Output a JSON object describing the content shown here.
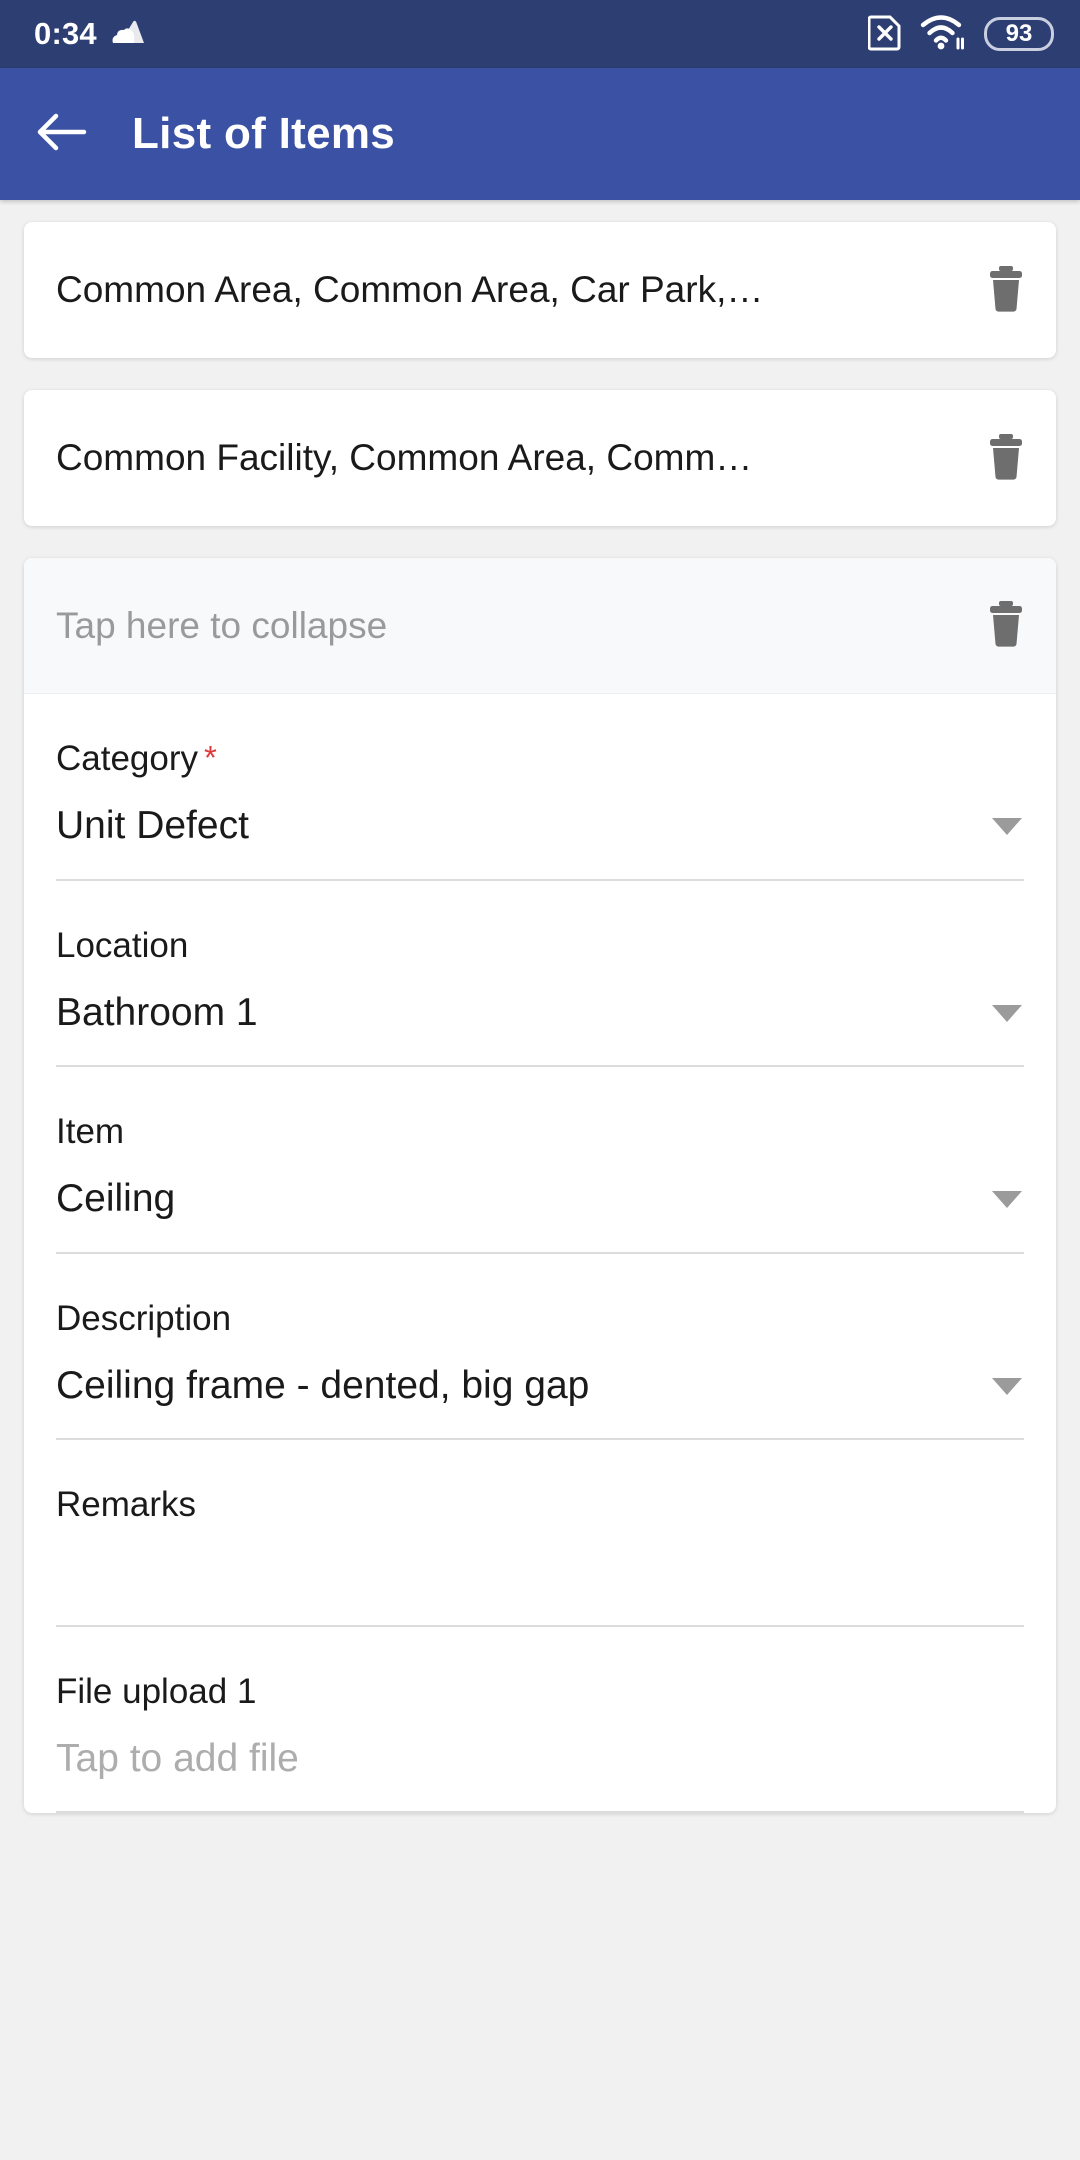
{
  "status_bar": {
    "time": "0:34",
    "cloud_icon": "cloud-icon",
    "sim_icon": "sim-card-x-icon",
    "wifi_icon": "wifi-icon",
    "battery_level": "93"
  },
  "app_bar": {
    "back_icon": "back-arrow-icon",
    "title": "List of Items"
  },
  "items": [
    {
      "title": "Common Area, Common Area, Car Park,…",
      "delete_icon": "trash-icon"
    },
    {
      "title": "Common Facility, Common Area, Comm…",
      "delete_icon": "trash-icon"
    }
  ],
  "expanded_item": {
    "collapse_hint": "Tap here to collapse",
    "delete_icon": "trash-icon",
    "fields": [
      {
        "label": "Category",
        "required": true,
        "required_marker": "*",
        "value": "Unit Defect",
        "has_dropdown": true,
        "is_placeholder": false
      },
      {
        "label": "Location",
        "required": false,
        "value": "Bathroom 1",
        "has_dropdown": true,
        "is_placeholder": false
      },
      {
        "label": "Item",
        "required": false,
        "value": "Ceiling",
        "has_dropdown": true,
        "is_placeholder": false
      },
      {
        "label": "Description",
        "required": false,
        "value": "Ceiling frame - dented, big gap",
        "has_dropdown": true,
        "is_placeholder": false
      },
      {
        "label": "Remarks",
        "required": false,
        "value": "",
        "has_dropdown": false,
        "is_placeholder": false
      },
      {
        "label": "File upload 1",
        "required": false,
        "value": "Tap to add file",
        "has_dropdown": false,
        "is_placeholder": true
      }
    ]
  },
  "colors": {
    "status_bar_bg": "#2D3E72",
    "app_bar_bg": "#3B51A4",
    "page_bg": "#F1F1F1",
    "card_bg": "#FFFFFF",
    "header_bg": "#F8F9FB",
    "required_star": "#E03B3B",
    "muted_text": "#9A9A9A",
    "underline": "#DCDCDC"
  }
}
